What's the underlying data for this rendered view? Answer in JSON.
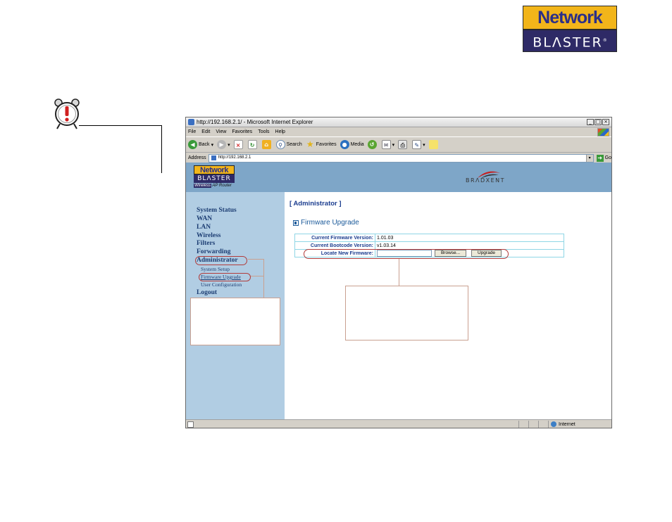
{
  "brand": {
    "line1": "Network",
    "line2": "BLΛSTER",
    "mark": "®"
  },
  "browser": {
    "title": "http://192.168.2.1/ - Microsoft Internet Explorer",
    "window_buttons": [
      "_",
      "□",
      "×"
    ],
    "menu": [
      "File",
      "Edit",
      "View",
      "Favorites",
      "Tools",
      "Help"
    ],
    "toolbar": {
      "back": "Back",
      "search": "Search",
      "favorites": "Favorites",
      "media": "Media"
    },
    "address_label": "Address",
    "address_value": "http://192.168.2.1",
    "go_label": "Go",
    "status_zone": "Internet"
  },
  "page": {
    "logo": {
      "line1": "Network",
      "line2": "BLΛSTER",
      "sub_a": "Wireless",
      "sub_b": "AP Router"
    },
    "partner_logo": "BRΛDXENT",
    "nav": [
      "System Status",
      "WAN",
      "LAN",
      "Wireless",
      "Filters",
      "Forwarding",
      "Administrator"
    ],
    "subnav": [
      "System Setup",
      "Firmware Upgrade",
      "User Configuration"
    ],
    "nav_last": "Logout",
    "section_title": "[ Administrator ]",
    "sub_title": "Firmware Upgrade",
    "rows": [
      {
        "label": "Current Firmware Version:",
        "value": "1.01.03"
      },
      {
        "label": "Current Bootcode Version:",
        "value": "v1.03.14"
      }
    ],
    "locate_label": "Locate New Firmware:",
    "browse_label": "Browse...",
    "upgrade_label": "Upgrade"
  },
  "colors": {
    "banner": "#7ea6c8",
    "sidebar": "#b1cde3",
    "nav_text": "#1c3d73",
    "annotation": "#b13c3c"
  }
}
